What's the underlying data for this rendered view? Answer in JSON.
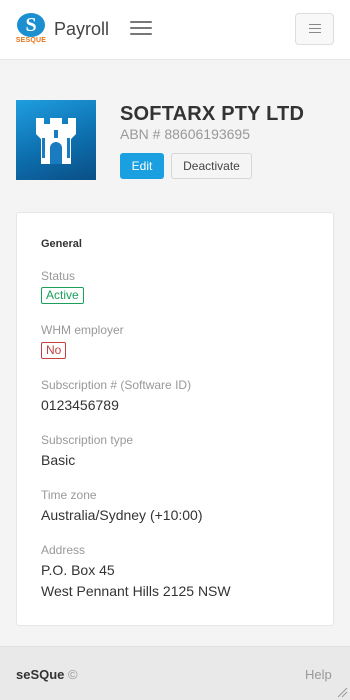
{
  "header": {
    "logo_text": "SESQUE",
    "logo_letter": "S",
    "app_title": "Payroll"
  },
  "company": {
    "name": "SOFTARX PTY LTD",
    "abn": "ABN # 88606193695",
    "edit_label": "Edit",
    "deactivate_label": "Deactivate"
  },
  "general": {
    "heading": "General",
    "status_label": "Status",
    "status_value": "Active",
    "whm_label": "WHM employer",
    "whm_value": "No",
    "subscription_label": "Subscription # (Software ID)",
    "subscription_value": "0123456789",
    "subscription_type_label": "Subscription type",
    "subscription_type_value": "Basic",
    "timezone_label": "Time zone",
    "timezone_value": "Australia/Sydney (+10:00)",
    "address_label": "Address",
    "address_line1": "P.O. Box 45",
    "address_line2": "West Pennant Hills 2125 NSW"
  },
  "footer": {
    "brand": "seSQue",
    "copyright": "©",
    "help_label": "Help"
  },
  "colors": {
    "accent": "#1aa0e0",
    "active_green": "#1aa05a",
    "no_red": "#c24040",
    "logo_orange": "#e8751a"
  }
}
